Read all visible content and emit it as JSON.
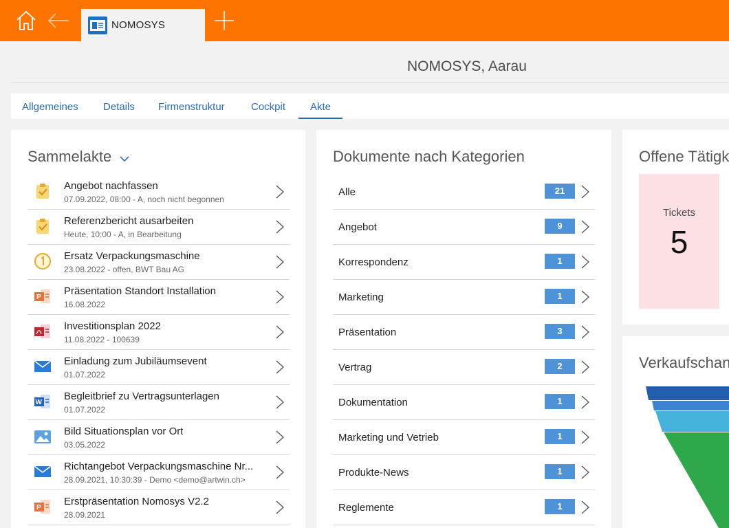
{
  "topbar": {
    "home_icon": "home-icon",
    "back_icon": "arrow-left-icon",
    "add_icon": "plus-icon",
    "tab": {
      "label": "NOMOSYS",
      "icon": "contact-card-icon"
    },
    "color": "#ff7300"
  },
  "page": {
    "title": "NOMOSYS, Aarau"
  },
  "tabs": [
    {
      "label": "Allgemeines"
    },
    {
      "label": "Details"
    },
    {
      "label": "Firmenstruktur"
    },
    {
      "label": "Cockpit"
    },
    {
      "label": "Akte",
      "active": true
    }
  ],
  "sammelakte": {
    "title": "Sammelakte",
    "items": [
      {
        "title": "Angebot nachfassen",
        "sub": "07.09.2022, 08:00 - A, noch nicht begonnen",
        "icon": "task-clipboard-icon"
      },
      {
        "title": "Referenzbericht ausarbeiten",
        "sub": "Heute, 10:00 - A, in Bearbeitung",
        "icon": "task-clipboard-icon"
      },
      {
        "title": "Ersatz Verpackungsmaschine",
        "sub": "23.08.2022 - offen, BWT Bau AG",
        "icon": "opportunity-icon"
      },
      {
        "title": "Präsentation Standort Installation",
        "sub": "16.08.2022",
        "icon": "powerpoint-icon"
      },
      {
        "title": "Investitionsplan 2022",
        "sub": "11.08.2022 - 100639",
        "icon": "pdf-icon"
      },
      {
        "title": "Einladung zum Jubiläumsevent",
        "sub": "01.07.2022",
        "icon": "mail-icon"
      },
      {
        "title": "Begleitbrief zu Vertragsunterlagen",
        "sub": "01.07.2022",
        "icon": "word-icon"
      },
      {
        "title": "Bild Situationsplan vor Ort",
        "sub": "03.05.2022",
        "icon": "image-icon"
      },
      {
        "title": "Richtangebot Verpackungsmaschine Nr...",
        "sub": "28.09.2021, 10:30:39 - Demo <demo@artwin.ch>",
        "icon": "mail-icon"
      },
      {
        "title": "Erstpräsentation Nomosys V2.2",
        "sub": "28.09.2021",
        "icon": "powerpoint-icon"
      }
    ]
  },
  "kategorien": {
    "title": "Dokumente nach Kategorien",
    "items": [
      {
        "label": "Alle",
        "count": "21"
      },
      {
        "label": "Angebot",
        "count": "9"
      },
      {
        "label": "Korrespondenz",
        "count": "1"
      },
      {
        "label": "Marketing",
        "count": "1"
      },
      {
        "label": "Präsentation",
        "count": "3"
      },
      {
        "label": "Vertrag",
        "count": "2"
      },
      {
        "label": "Dokumentation",
        "count": "1"
      },
      {
        "label": "Marketing und Vetrieb",
        "count": "1"
      },
      {
        "label": "Produkte-News",
        "count": "1"
      },
      {
        "label": "Reglemente",
        "count": "1"
      }
    ]
  },
  "offene": {
    "title": "Offene Tätigk",
    "tickets_label": "Tickets",
    "tickets_value": "5"
  },
  "verkauf": {
    "title": "Verkaufschan",
    "funnel_colors": [
      "#1f5fae",
      "#3a84d0",
      "#45b2dc",
      "#2ea84a"
    ]
  }
}
